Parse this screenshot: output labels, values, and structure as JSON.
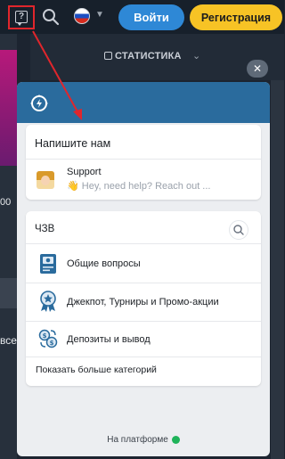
{
  "topbar": {
    "login_label": "Войти",
    "register_label": "Регистрация"
  },
  "background": {
    "stat_label": "СТАТИСТИКА",
    "left_text_1": "00",
    "left_text_2": "всe"
  },
  "widget": {
    "close_symbol": "✕",
    "contact": {
      "title": "Напишите нам",
      "support_name": "Support",
      "support_message": "👋 Hey, need help? Reach out ..."
    },
    "faq": {
      "title": "ЧЗВ",
      "categories": [
        {
          "label": "Общие вопросы",
          "icon": "passport-icon"
        },
        {
          "label": "Джекпот, Турниры и Промо-акции",
          "icon": "award-badge-icon"
        },
        {
          "label": "Депозиты и вывод",
          "icon": "money-exchange-icon"
        }
      ],
      "more_label": "Показать больше категорий"
    },
    "footer_label": "На платформе"
  },
  "colors": {
    "header_blue": "#2a6b9d",
    "login_blue": "#2e88d6",
    "register_yellow": "#f7c325",
    "highlight_red": "#e0262c"
  }
}
